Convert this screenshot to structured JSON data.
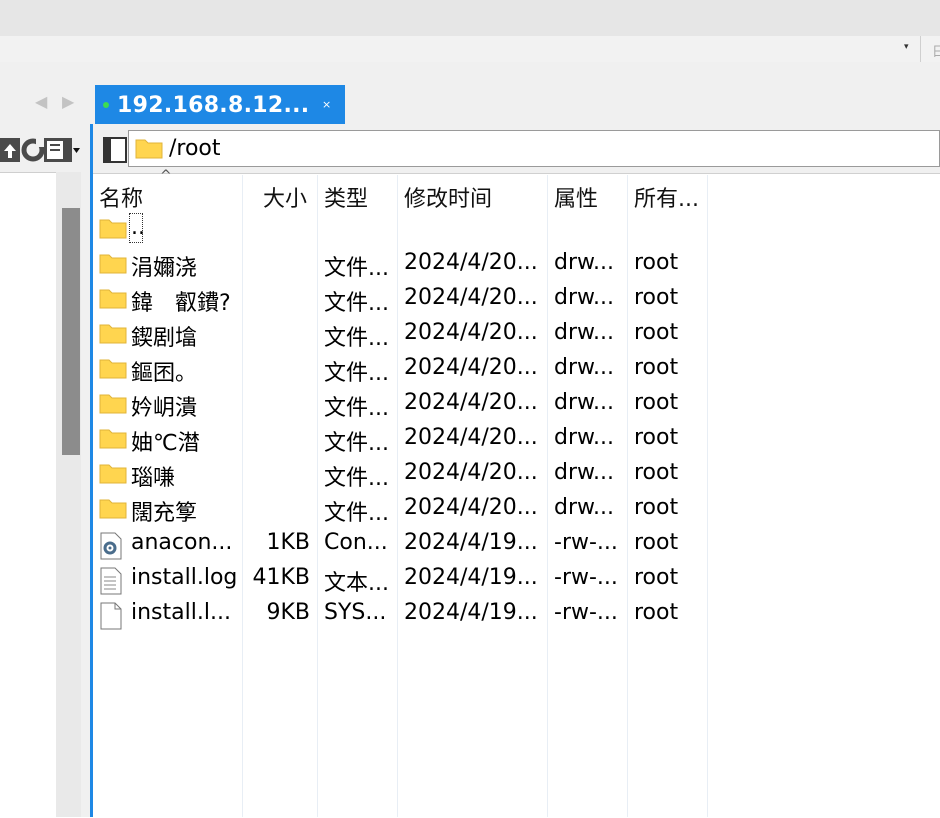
{
  "tab": {
    "title": "192.168.8.12...",
    "close": "×"
  },
  "toolbar": {
    "overflow": "▾",
    "edge_text": "日"
  },
  "path": {
    "value": "/root"
  },
  "columns": {
    "name": "名称",
    "size": "大小",
    "type": "类型",
    "modified": "修改时间",
    "perm": "属性",
    "owner": "所有..."
  },
  "sort_indicator": "^",
  "files": [
    {
      "kind": "folder",
      "name": "..",
      "size": "",
      "type": "",
      "modified": "",
      "perm": "",
      "owner": ""
    },
    {
      "kind": "folder",
      "name": "涓嬭浇",
      "size": "",
      "type": "文件...",
      "modified": "2024/4/20...",
      "perm": "drw...",
      "owner": "root"
    },
    {
      "kind": "folder",
      "name": "鍏　叡鐨?",
      "size": "",
      "type": "文件...",
      "modified": "2024/4/20...",
      "perm": "drw...",
      "owner": "root"
    },
    {
      "kind": "folder",
      "name": "鍥剧墖",
      "size": "",
      "type": "文件...",
      "modified": "2024/4/20...",
      "perm": "drw...",
      "owner": "root"
    },
    {
      "kind": "folder",
      "name": "鏂囨。",
      "size": "",
      "type": "文件...",
      "modified": "2024/4/20...",
      "perm": "drw...",
      "owner": "root"
    },
    {
      "kind": "folder",
      "name": "妗岄潰",
      "size": "",
      "type": "文件...",
      "modified": "2024/4/20...",
      "perm": "drw...",
      "owner": "root"
    },
    {
      "kind": "folder",
      "name": "妯℃澘",
      "size": "",
      "type": "文件...",
      "modified": "2024/4/20...",
      "perm": "drw...",
      "owner": "root"
    },
    {
      "kind": "folder",
      "name": "瑙嗛",
      "size": "",
      "type": "文件...",
      "modified": "2024/4/20...",
      "perm": "drw...",
      "owner": "root"
    },
    {
      "kind": "folder",
      "name": "闊充箰",
      "size": "",
      "type": "文件...",
      "modified": "2024/4/20...",
      "perm": "drw...",
      "owner": "root"
    },
    {
      "kind": "config",
      "name": "anacon...",
      "size": "1KB",
      "type": "Con...",
      "modified": "2024/4/19...",
      "perm": "-rw-...",
      "owner": "root"
    },
    {
      "kind": "text",
      "name": "install.log",
      "size": "41KB",
      "type": "文本...",
      "modified": "2024/4/19...",
      "perm": "-rw-...",
      "owner": "root"
    },
    {
      "kind": "file",
      "name": "install.l...",
      "size": "9KB",
      "type": "SYS...",
      "modified": "2024/4/19...",
      "perm": "-rw-...",
      "owner": "root"
    }
  ],
  "colors": {
    "accent": "#1e88e5",
    "folder": "#ffd54f",
    "connected": "#3ddc52"
  }
}
